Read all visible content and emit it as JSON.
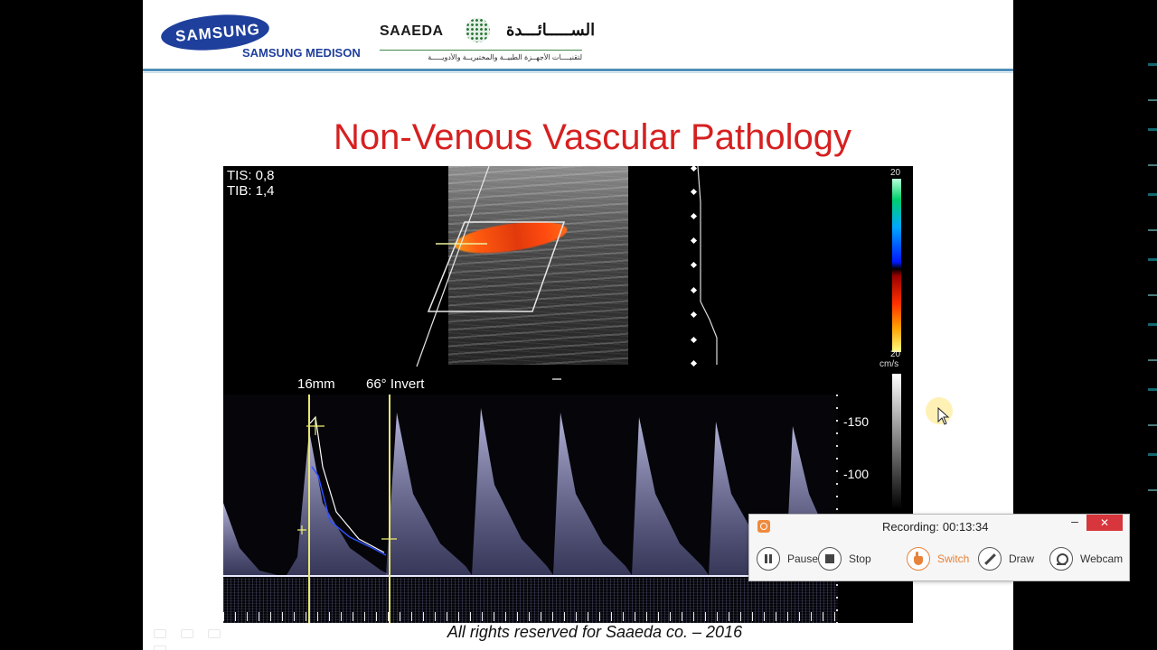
{
  "header": {
    "samsung_logo_text": "SAMSUNG",
    "samsung_medison_text": "SAMSUNG MEDISON",
    "saaeda_text": "SAAEDA",
    "saaeda_arabic": "الســـــائـــدة",
    "saaeda_tagline": "لتقنيــــات الأجهــزة الطبيــة والمختبريــة والأدويـــــة"
  },
  "slide": {
    "title": "Non-Venous Vascular Pathology",
    "footer": "All rights reserved for Saaeda co. – 2016"
  },
  "ultrasound": {
    "tis": "TIS: 0,8",
    "tib": "TIB: 1,4",
    "gate_size": "16mm",
    "angle": "66° Invert",
    "colorbar_top": "20",
    "colorbar_bottom": "20",
    "velocity_unit": "cm/s",
    "scale_labels": [
      "-150",
      "-100"
    ]
  },
  "recorder": {
    "status_label": "Recording:",
    "elapsed": "00:13:34",
    "minimize_symbol": "–",
    "close_symbol": "✕",
    "buttons": {
      "pause": "Pause",
      "stop": "Stop",
      "switch": "Switch",
      "draw": "Draw",
      "webcam": "Webcam"
    }
  }
}
